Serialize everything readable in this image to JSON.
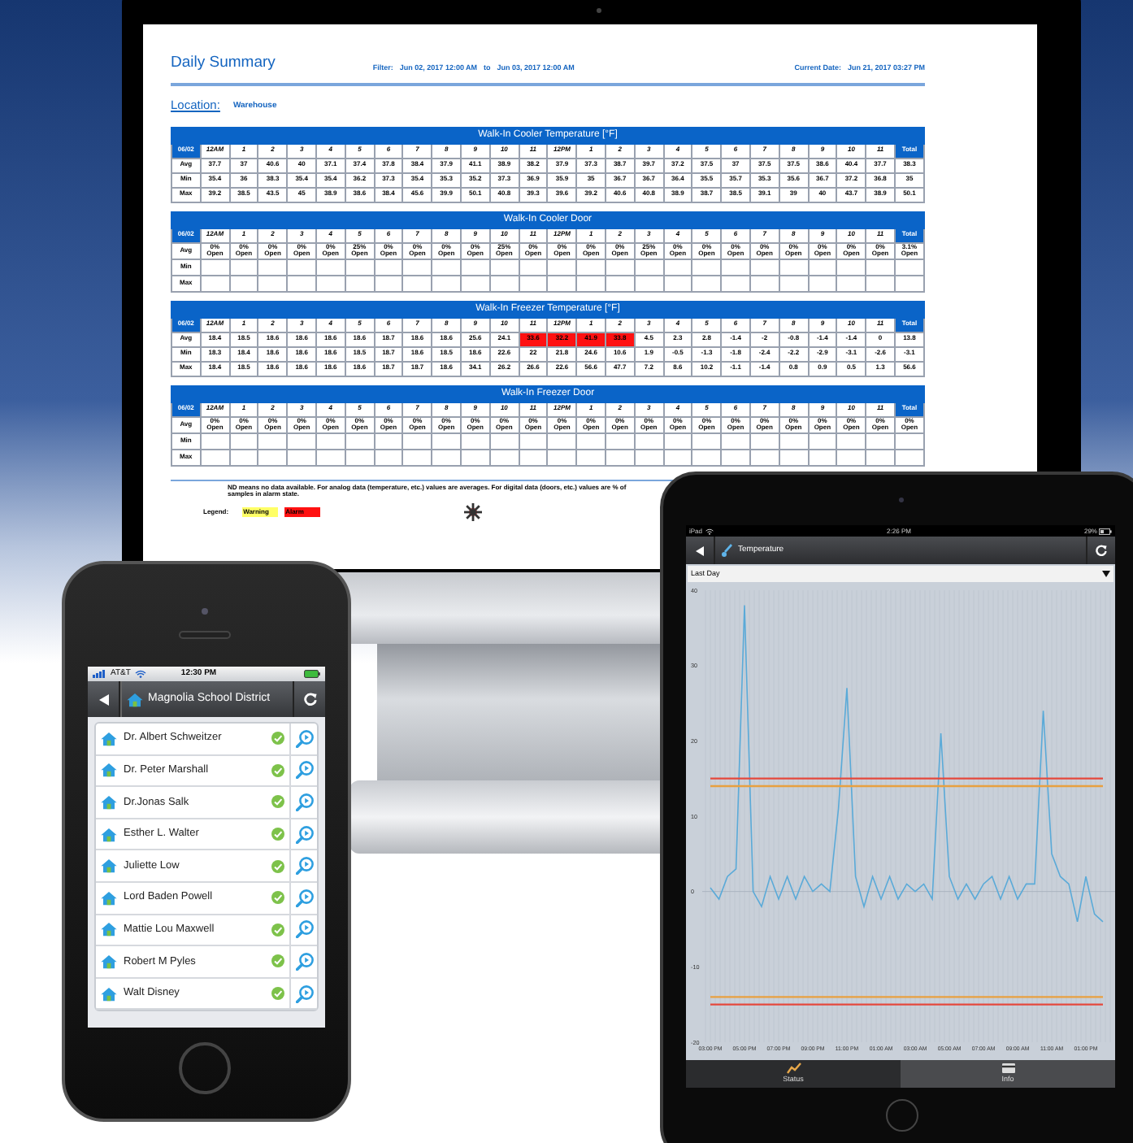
{
  "report": {
    "title": "Daily Summary",
    "filter_label": "Filter:",
    "filter_from": "Jun 02, 2017 12:00 AM",
    "to_label": "to",
    "filter_to": "Jun 03, 2017 12:00 AM",
    "current_date_label": "Current Date:",
    "current_date": "Jun 21, 2017 03:27 PM",
    "location_label": "Location:",
    "location": "Warehouse",
    "tables": [
      {
        "title": "Walk-In Cooler Temperature [°F]",
        "kind": "temperature",
        "columns": [
          "06/02",
          "12AM",
          "1",
          "2",
          "3",
          "4",
          "5",
          "6",
          "7",
          "8",
          "9",
          "10",
          "11",
          "12PM",
          "1",
          "2",
          "3",
          "4",
          "5",
          "6",
          "7",
          "8",
          "9",
          "10",
          "11",
          "Total"
        ],
        "rows": [
          {
            "label": "Avg",
            "values": [
              "37.7",
              "37",
              "40.6",
              "40",
              "37.1",
              "37.4",
              "37.8",
              "38.4",
              "37.9",
              "41.1",
              "38.9",
              "38.2",
              "37.9",
              "37.3",
              "38.7",
              "39.7",
              "37.2",
              "37.5",
              "37",
              "37.5",
              "37.5",
              "38.6",
              "40.4",
              "37.7",
              "38.3"
            ]
          },
          {
            "label": "Min",
            "values": [
              "35.4",
              "36",
              "38.3",
              "35.4",
              "35.4",
              "36.2",
              "37.3",
              "35.4",
              "35.3",
              "35.2",
              "37.3",
              "36.9",
              "35.9",
              "35",
              "36.7",
              "36.7",
              "36.4",
              "35.5",
              "35.7",
              "35.3",
              "35.6",
              "36.7",
              "37.2",
              "36.8",
              "35"
            ]
          },
          {
            "label": "Max",
            "values": [
              "39.2",
              "38.5",
              "43.5",
              "45",
              "38.9",
              "38.6",
              "38.4",
              "45.6",
              "39.9",
              "50.1",
              "40.8",
              "39.3",
              "39.6",
              "39.2",
              "40.6",
              "40.8",
              "38.9",
              "38.7",
              "38.5",
              "39.1",
              "39",
              "40",
              "43.7",
              "38.9",
              "50.1"
            ]
          }
        ]
      },
      {
        "title": "Walk-In Cooler Door",
        "kind": "door",
        "columns": [
          "06/02",
          "12AM",
          "1",
          "2",
          "3",
          "4",
          "5",
          "6",
          "7",
          "8",
          "9",
          "10",
          "11",
          "12PM",
          "1",
          "2",
          "3",
          "4",
          "5",
          "6",
          "7",
          "8",
          "9",
          "10",
          "11",
          "Total"
        ],
        "rows": [
          {
            "label": "Avg",
            "values": [
              "0% Open",
              "0% Open",
              "0% Open",
              "0% Open",
              "0% Open",
              "25% Open",
              "0% Open",
              "0% Open",
              "0% Open",
              "0% Open",
              "25% Open",
              "0% Open",
              "0% Open",
              "0% Open",
              "0% Open",
              "25% Open",
              "0% Open",
              "0% Open",
              "0% Open",
              "0% Open",
              "0% Open",
              "0% Open",
              "0% Open",
              "0% Open",
              "3.1% Open"
            ]
          },
          {
            "label": "Min"
          },
          {
            "label": "Max"
          }
        ]
      },
      {
        "title": "Walk-In Freezer Temperature [°F]",
        "kind": "temperature",
        "columns": [
          "06/02",
          "12AM",
          "1",
          "2",
          "3",
          "4",
          "5",
          "6",
          "7",
          "8",
          "9",
          "10",
          "11",
          "12PM",
          "1",
          "2",
          "3",
          "4",
          "5",
          "6",
          "7",
          "8",
          "9",
          "10",
          "11",
          "Total"
        ],
        "rows": [
          {
            "label": "Avg",
            "values": [
              "18.4",
              "18.5",
              "18.6",
              "18.6",
              "18.6",
              "18.6",
              "18.7",
              "18.6",
              "18.6",
              "25.6",
              "24.1",
              "33.6",
              "32.2",
              "41.9",
              "33.8",
              "4.5",
              "2.3",
              "2.8",
              "-1.4",
              "-2",
              "-0.8",
              "-1.4",
              "-1.4",
              "0",
              "13.8"
            ],
            "alarm": [
              false,
              false,
              false,
              false,
              false,
              false,
              false,
              false,
              false,
              false,
              false,
              true,
              true,
              true,
              true,
              false,
              false,
              false,
              false,
              false,
              false,
              false,
              false,
              false,
              false
            ]
          },
          {
            "label": "Min",
            "values": [
              "18.3",
              "18.4",
              "18.6",
              "18.6",
              "18.6",
              "18.5",
              "18.7",
              "18.6",
              "18.5",
              "18.6",
              "22.6",
              "22",
              "21.8",
              "24.6",
              "10.6",
              "1.9",
              "-0.5",
              "-1.3",
              "-1.8",
              "-2.4",
              "-2.2",
              "-2.9",
              "-3.1",
              "-2.6",
              "-3.1"
            ]
          },
          {
            "label": "Max",
            "values": [
              "18.4",
              "18.5",
              "18.6",
              "18.6",
              "18.6",
              "18.6",
              "18.7",
              "18.7",
              "18.6",
              "34.1",
              "26.2",
              "26.6",
              "22.6",
              "56.6",
              "47.7",
              "7.2",
              "8.6",
              "10.2",
              "-1.1",
              "-1.4",
              "0.8",
              "0.9",
              "0.5",
              "1.3",
              "56.6"
            ]
          }
        ]
      },
      {
        "title": "Walk-In Freezer Door",
        "kind": "door",
        "columns": [
          "06/02",
          "12AM",
          "1",
          "2",
          "3",
          "4",
          "5",
          "6",
          "7",
          "8",
          "9",
          "10",
          "11",
          "12PM",
          "1",
          "2",
          "3",
          "4",
          "5",
          "6",
          "7",
          "8",
          "9",
          "10",
          "11",
          "Total"
        ],
        "rows": [
          {
            "label": "Avg",
            "values": [
              "0% Open",
              "0% Open",
              "0% Open",
              "0% Open",
              "0% Open",
              "0% Open",
              "0% Open",
              "0% Open",
              "0% Open",
              "0% Open",
              "0% Open",
              "0% Open",
              "0% Open",
              "0% Open",
              "0% Open",
              "0% Open",
              "0% Open",
              "0% Open",
              "0% Open",
              "0% Open",
              "0% Open",
              "0% Open",
              "0% Open",
              "0% Open",
              "0% Open"
            ]
          },
          {
            "label": "Min"
          },
          {
            "label": "Max"
          }
        ]
      }
    ],
    "note": "ND means no data available. For analog data (temperature, etc.) values are averages. For digital data (doors, etc.) values are % of samples in alarm state.",
    "legend": {
      "label": "Legend:",
      "items": [
        {
          "label": "Warning",
          "color": "#ffff66"
        },
        {
          "label": "Alarm",
          "color": "#ff1111"
        }
      ]
    }
  },
  "phone": {
    "carrier": "AT&T",
    "time": "12:30 PM",
    "title": "Magnolia School District",
    "items": [
      {
        "name": "Dr. Albert Schweitzer",
        "ok": true
      },
      {
        "name": "Dr. Peter Marshall",
        "ok": true
      },
      {
        "name": "Dr.Jonas Salk",
        "ok": true
      },
      {
        "name": "Esther L. Walter",
        "ok": true
      },
      {
        "name": "Juliette Low",
        "ok": true
      },
      {
        "name": "Lord Baden Powell",
        "ok": true
      },
      {
        "name": "Mattie Lou Maxwell",
        "ok": true
      },
      {
        "name": "Robert M Pyles",
        "ok": true
      },
      {
        "name": "Walt Disney",
        "ok": true
      }
    ]
  },
  "tablet": {
    "device": "iPad",
    "time": "2:26 PM",
    "battery": "29%",
    "title": "Temperature",
    "range": "Last Day",
    "chart_data": {
      "type": "line",
      "categories": [
        "03:00 PM",
        null,
        null,
        null,
        "05:00 PM",
        null,
        null,
        null,
        "07:00 PM",
        null,
        null,
        null,
        "09:00 PM",
        null,
        null,
        null,
        "11:00 PM",
        null,
        null,
        null,
        "01:00 AM",
        null,
        null,
        null,
        "03:00 AM",
        null,
        null,
        null,
        "05:00 AM",
        null,
        null,
        null,
        "07:00 AM",
        null,
        null,
        null,
        "09:00 AM",
        null,
        null,
        null,
        "11:00 AM",
        null,
        null,
        null,
        "01:00 PM",
        null,
        null
      ],
      "series": [
        {
          "color": "#5aaad8",
          "values": [
            0.5,
            -1,
            2,
            3,
            38,
            0,
            -2,
            2,
            -1,
            2,
            -1,
            2,
            0,
            1,
            0,
            11,
            27,
            2,
            -2,
            2,
            -1,
            2,
            -1,
            1,
            0,
            1,
            -1,
            21,
            2,
            -1,
            1,
            -1,
            1,
            2,
            -1,
            2,
            -1,
            1,
            1,
            24,
            5,
            2,
            1,
            -4,
            2,
            -3,
            -4
          ]
        },
        {
          "color": "#e5483c",
          "values": [
            15,
            15,
            15,
            15,
            15,
            15,
            15,
            15,
            15,
            15,
            15,
            15,
            15,
            15,
            15,
            15,
            15,
            15,
            15,
            15,
            15,
            15,
            15,
            15,
            15,
            15,
            15,
            15,
            15,
            15,
            15,
            15,
            15,
            15,
            15,
            15,
            15,
            15,
            15,
            15,
            15,
            15,
            15,
            15,
            15,
            15,
            15
          ]
        },
        {
          "color": "#e8a040",
          "values": [
            14,
            14,
            14,
            14,
            14,
            14,
            14,
            14,
            14,
            14,
            14,
            14,
            14,
            14,
            14,
            14,
            14,
            14,
            14,
            14,
            14,
            14,
            14,
            14,
            14,
            14,
            14,
            14,
            14,
            14,
            14,
            14,
            14,
            14,
            14,
            14,
            14,
            14,
            14,
            14,
            14,
            14,
            14,
            14,
            14,
            14,
            14
          ]
        },
        {
          "color": "#e8a040",
          "values": [
            -14,
            -14,
            -14,
            -14,
            -14,
            -14,
            -14,
            -14,
            -14,
            -14,
            -14,
            -14,
            -14,
            -14,
            -14,
            -14,
            -14,
            -14,
            -14,
            -14,
            -14,
            -14,
            -14,
            -14,
            -14,
            -14,
            -14,
            -14,
            -14,
            -14,
            -14,
            -14,
            -14,
            -14,
            -14,
            -14,
            -14,
            -14,
            -14,
            -14,
            -14,
            -14,
            -14,
            -14,
            -14,
            -14,
            -14
          ]
        },
        {
          "color": "#e5483c",
          "values": [
            -15,
            -15,
            -15,
            -15,
            -15,
            -15,
            -15,
            -15,
            -15,
            -15,
            -15,
            -15,
            -15,
            -15,
            -15,
            -15,
            -15,
            -15,
            -15,
            -15,
            -15,
            -15,
            -15,
            -15,
            -15,
            -15,
            -15,
            -15,
            -15,
            -15,
            -15,
            -15,
            -15,
            -15,
            -15,
            -15,
            -15,
            -15,
            -15,
            -15,
            -15,
            -15,
            -15,
            -15,
            -15,
            -15,
            -15
          ]
        }
      ],
      "ylim": [
        -20,
        40
      ],
      "yticks": [
        -20,
        -10,
        0,
        10,
        20,
        30,
        40
      ],
      "grid": true
    },
    "tabs": [
      {
        "label": "Status",
        "kind": "chart",
        "selected": true
      },
      {
        "label": "Info",
        "kind": "card",
        "selected": false
      }
    ]
  }
}
